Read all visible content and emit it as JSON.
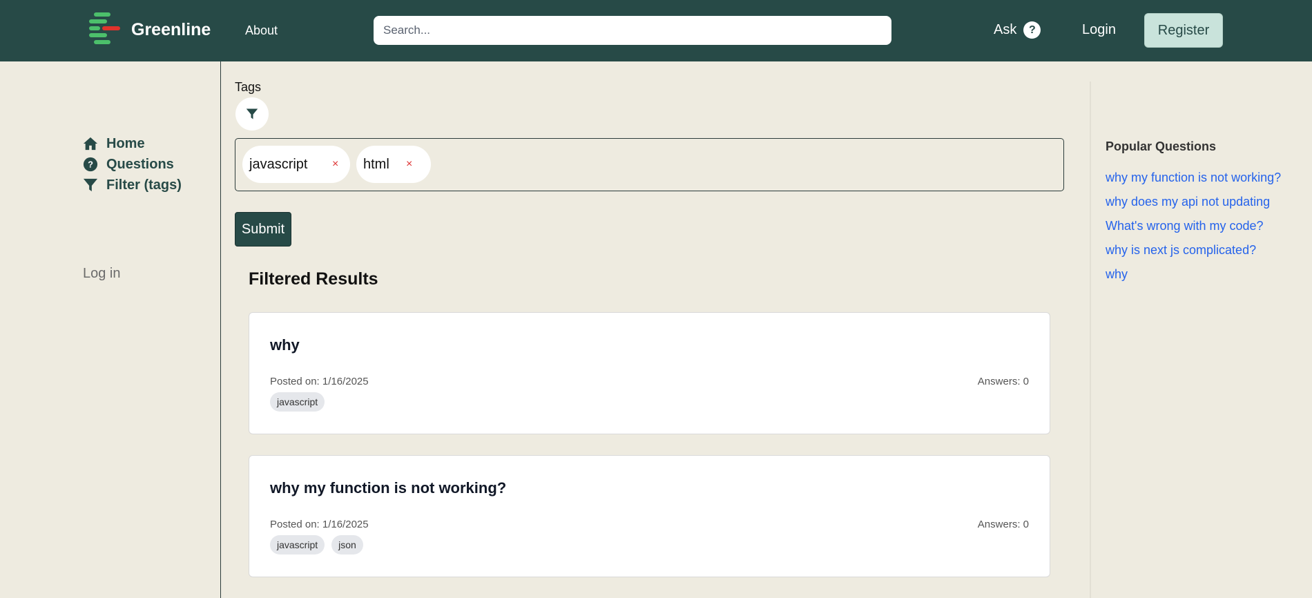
{
  "header": {
    "brand": "Greenline",
    "about": "About",
    "search_placeholder": "Search...",
    "ask": "Ask",
    "ask_icon": "?",
    "login": "Login",
    "register": "Register"
  },
  "sidebar": {
    "items": [
      {
        "label": "Home",
        "icon": "home-icon"
      },
      {
        "label": "Questions",
        "icon": "question-circle-icon"
      },
      {
        "label": "Filter (tags)",
        "icon": "filter-icon"
      }
    ],
    "login": "Log in"
  },
  "filter": {
    "label": "Tags",
    "chips": [
      "javascript",
      "html"
    ],
    "remove_symbol": "×",
    "submit": "Submit"
  },
  "results": {
    "title": "Filtered Results",
    "items": [
      {
        "title": "why",
        "posted": "Posted on: 1/16/2025",
        "answers": "Answers: 0",
        "tags": [
          "javascript"
        ]
      },
      {
        "title": "why my function is not working?",
        "posted": "Posted on: 1/16/2025",
        "answers": "Answers: 0",
        "tags": [
          "javascript",
          "json"
        ]
      }
    ]
  },
  "popular": {
    "title": "Popular Questions",
    "items": [
      "why my function is not working?",
      "why does my api not updating",
      "What's wrong with my code?",
      "why is next js complicated?",
      "why"
    ]
  },
  "colors": {
    "header_bg": "#274a47",
    "page_bg": "#eeebe0",
    "accent": "#274a47",
    "register_bg": "#c9e3db",
    "link": "#2563eb",
    "logo_green": "#4cbf6b",
    "logo_red": "#e0332c"
  }
}
